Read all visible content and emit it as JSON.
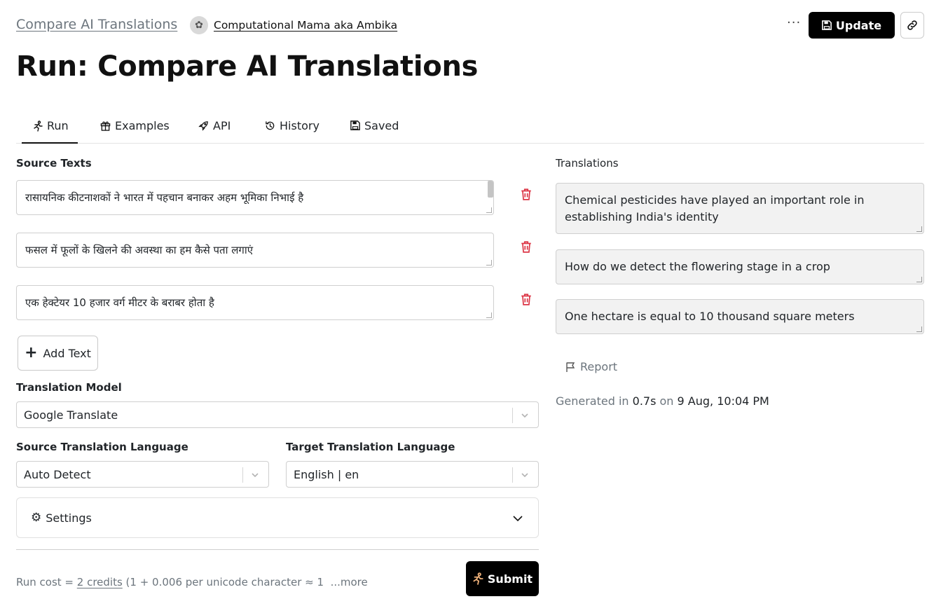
{
  "header": {
    "site_link": "Compare AI Translations",
    "author_name": "Computational Mama aka Ambika",
    "more_label": "···",
    "update_label": "Update"
  },
  "page_title": "Run: Compare AI Translations",
  "tabs": [
    {
      "label": "Run",
      "icon": "run-icon",
      "active": true
    },
    {
      "label": "Examples",
      "icon": "gift-icon",
      "active": false
    },
    {
      "label": "API",
      "icon": "rocket-icon",
      "active": false
    },
    {
      "label": "History",
      "icon": "history-icon",
      "active": false
    },
    {
      "label": "Saved",
      "icon": "save-icon",
      "active": false
    }
  ],
  "source": {
    "label": "Source Texts",
    "texts": [
      "रासायनिक कीटनाशकों ने भारत में पहचान बनाकर अहम भूमिका निभाई है",
      "फसल में फूलों के खिलने की अवस्था का हम कैसे पता लगाएं",
      "एक हेक्टेयर 10 हजार वर्ग मीटर के बराबर होता है"
    ],
    "add_label": "Add Text"
  },
  "model": {
    "label": "Translation Model",
    "value": "Google Translate"
  },
  "languages": {
    "source_label": "Source Translation Language",
    "source_value": "Auto Detect",
    "target_label": "Target Translation Language",
    "target_value": "English | en"
  },
  "settings_label": "Settings",
  "run_cost": {
    "prefix": "Run cost = ",
    "credits": "2 credits",
    "suffix": " (1 + 0.006 per unicode character ≈ 1",
    "more": "...more"
  },
  "submit_label": "Submit",
  "translations": {
    "label": "Translations",
    "outputs": [
      "Chemical pesticides have played an important role in establishing India's identity",
      "How do we detect the flowering stage in a crop",
      "One hectare is equal to 10 thousand square meters"
    ]
  },
  "report_label": "Report",
  "generated": {
    "prefix": "Generated in ",
    "time": "0.7s",
    "middle": " on ",
    "date": "9 Aug, 10:04 PM"
  },
  "colors": {
    "accent": "#000000",
    "danger": "#dc3545",
    "muted": "#6c757d",
    "output_bg": "#f2f2f2"
  }
}
